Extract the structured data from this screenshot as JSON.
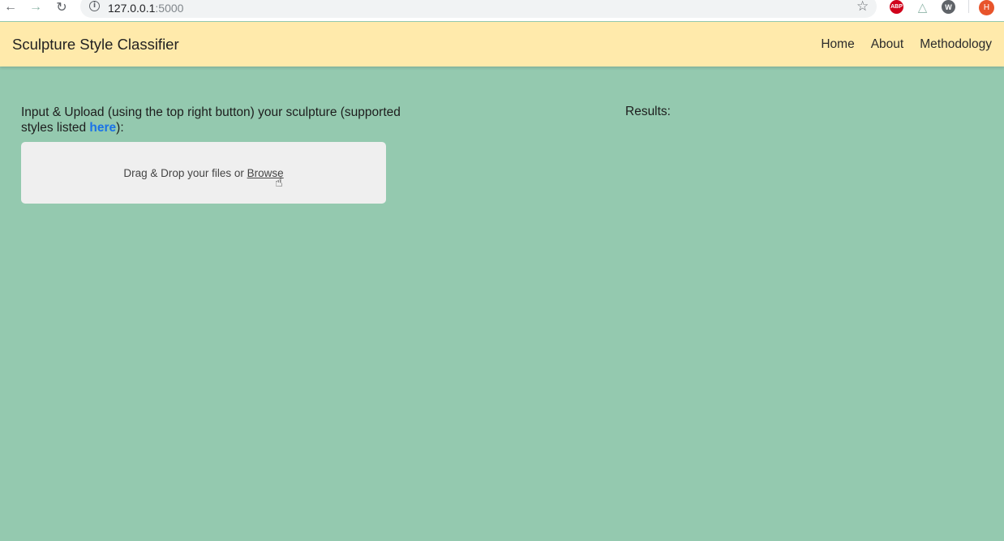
{
  "browser": {
    "url_host": "127.0.0.1",
    "url_port": ":5000",
    "back_icon": "←",
    "forward_icon": "→",
    "reload_icon": "↻",
    "star_icon": "☆",
    "ext_abp": "ABP",
    "ext_drive": "△",
    "ext_w": "W",
    "avatar": "H"
  },
  "navbar": {
    "brand": "Sculpture Style Classifier",
    "links": [
      "Home",
      "About",
      "Methodology"
    ]
  },
  "main": {
    "input_label_part1": "Input & Upload (using the top right button) your sculpture (supported styles listed ",
    "input_label_link": "here",
    "input_label_part2": "):",
    "dropzone_text": "Drag & Drop your files or ",
    "dropzone_browse": "Browse",
    "results_label": "Results:"
  },
  "colors": {
    "page_bg": "#94c9af",
    "navbar_bg": "#ffeaab",
    "dropzone_bg": "#efefef",
    "link": "#1a73e8"
  }
}
